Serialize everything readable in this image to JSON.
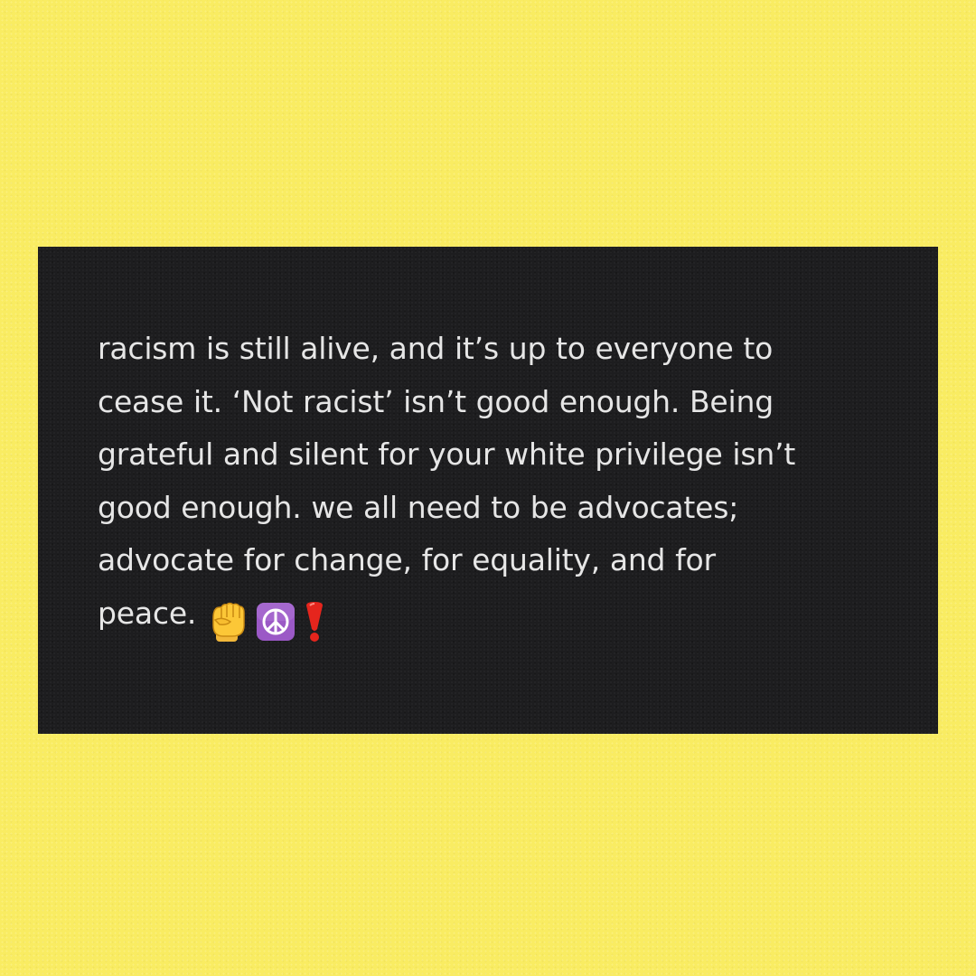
{
  "note": {
    "lines": [
      "racism is still alive, and it’s up to everyone to",
      "cease it. ‘Not racist’ isn’t good enough. Being",
      "grateful and silent for your white privilege isn’t",
      "good enough. we all need to be advocates;",
      "advocate for change, for equality, and for",
      "peace."
    ],
    "emojis": [
      "raised-fist",
      "peace-symbol",
      "red-exclamation-mark"
    ]
  },
  "colors": {
    "background": "#f9ec62",
    "card": "#1d1d1f",
    "text": "#e6e6e6"
  }
}
